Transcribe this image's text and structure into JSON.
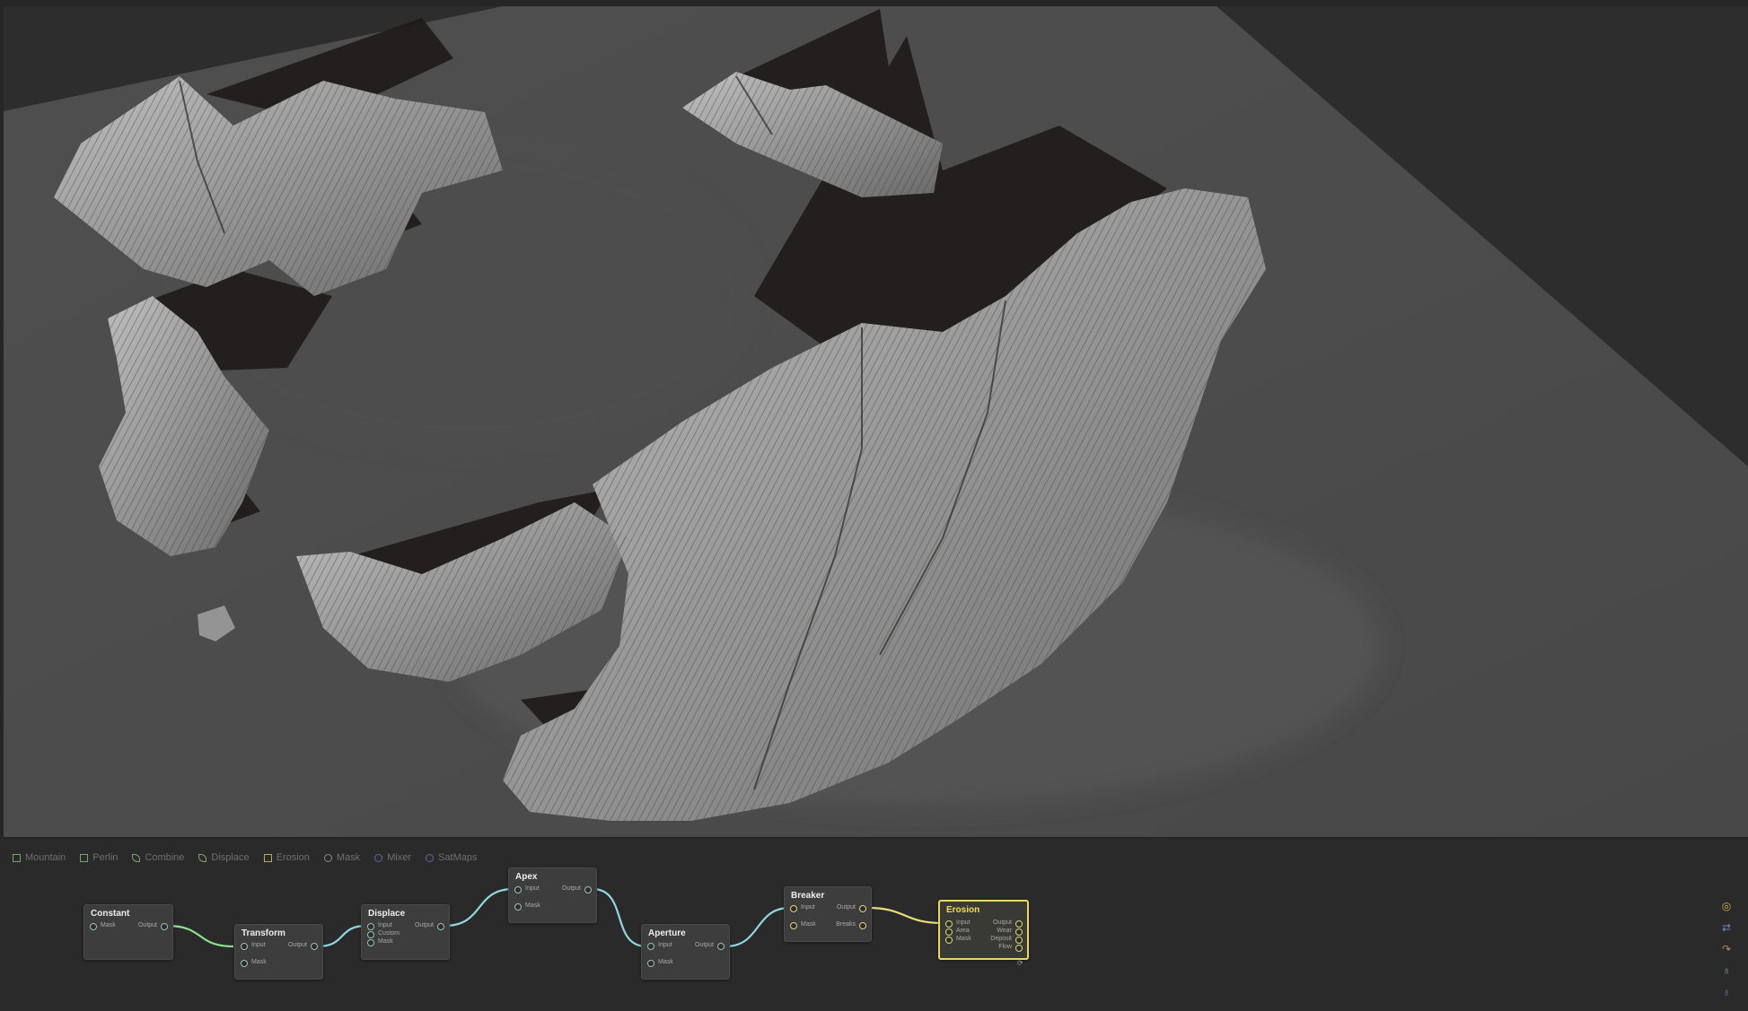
{
  "toolbox": [
    {
      "label": "Mountain",
      "icon": "mountain-icon",
      "style": "ic-square"
    },
    {
      "label": "Perlin",
      "icon": "perlin-icon",
      "style": "ic-square"
    },
    {
      "label": "Combine",
      "icon": "combine-icon",
      "style": "ic-leaf"
    },
    {
      "label": "Displace",
      "icon": "displace-icon",
      "style": "ic-leaf"
    },
    {
      "label": "Erosion",
      "icon": "erosion-icon",
      "style": "ic-square-y"
    },
    {
      "label": "Mask",
      "icon": "mask-icon",
      "style": "ic-circle"
    },
    {
      "label": "Mixer",
      "icon": "mixer-icon",
      "style": "ic-circle-b"
    },
    {
      "label": "SatMaps",
      "icon": "satmaps-icon",
      "style": "ic-circle-p"
    }
  ],
  "nodes": {
    "constant": {
      "title": "Constant",
      "in": [
        "Mask"
      ],
      "out": [
        "Output"
      ]
    },
    "transform": {
      "title": "Transform",
      "in": [
        "Input",
        "Mask"
      ],
      "out": [
        "Output"
      ]
    },
    "displace": {
      "title": "Displace",
      "in": [
        "Input",
        "Custom",
        "Mask"
      ],
      "out": [
        "Output"
      ]
    },
    "apex": {
      "title": "Apex",
      "in": [
        "Input",
        "Mask"
      ],
      "out": [
        "Output"
      ]
    },
    "aperture": {
      "title": "Aperture",
      "in": [
        "Input",
        "Mask"
      ],
      "out": [
        "Output"
      ]
    },
    "breaker": {
      "title": "Breaker",
      "in": [
        "Input",
        "Mask"
      ],
      "out": [
        "Output",
        "Breaks"
      ]
    },
    "erosion": {
      "title": "Erosion",
      "in": [
        "Input",
        "Area",
        "Mask"
      ],
      "out": [
        "Output",
        "Wear",
        "Deposit",
        "Flow"
      ]
    }
  },
  "colors": {
    "wire_green": "#8fe08a",
    "wire_cyan": "#8fd8e0",
    "wire_yellow": "#e9dc7a",
    "selected_border": "#e8d66a",
    "terrain_background": "#4a4a4a"
  },
  "side_icons": [
    "target-icon",
    "swap-arrows-icon",
    "route-icon",
    "lock-green-icon",
    "lock-purple-icon"
  ]
}
